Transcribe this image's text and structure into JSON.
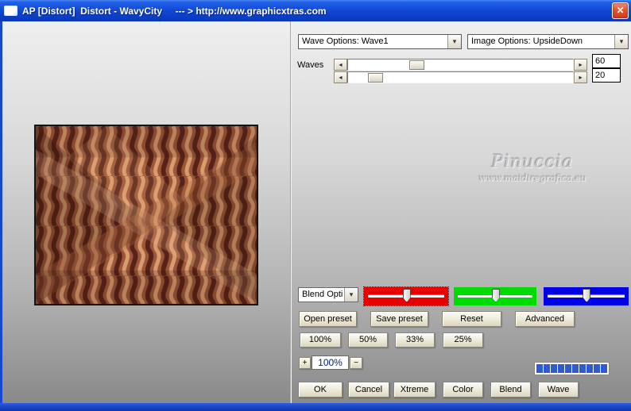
{
  "window": {
    "title": "AP [Distort]  Distort - WavyCity     --- > http://www.graphicxtras.com"
  },
  "icons": {
    "close": "✕",
    "dropdown_arrow": "▾",
    "arrow_left": "◂",
    "arrow_right": "▸",
    "plus": "+",
    "minus": "−"
  },
  "controls": {
    "wave_options_dropdown": "Wave Options: Wave1",
    "image_options_dropdown": "Image Options: UpsideDown",
    "waves_label": "Waves",
    "waves_value_top": "60",
    "waves_value_bottom": "20",
    "blend_dropdown": "Blend Opti",
    "zoom_value": "100%"
  },
  "watermark": {
    "name": "Pinuccia",
    "site": "www.maidiregrafica.eu"
  },
  "buttons": {
    "preset_row": [
      "Open preset",
      "Save preset",
      "Reset",
      "Advanced"
    ],
    "percent_row": [
      "100%",
      "50%",
      "33%",
      "25%"
    ],
    "action_row": [
      "OK",
      "Cancel",
      "Xtreme",
      "Color",
      "Blend",
      "Wave"
    ]
  },
  "colors": {
    "title_bar": "#0f45d2",
    "red_slider": "#e60000",
    "green_slider": "#00dc00",
    "blue_slider": "#0000e6",
    "progress_segment": "#2e5bd0",
    "preview_dark_brown": "#572318",
    "preview_mid_brown": "#9a573a",
    "preview_light_brown": "#d99c6c"
  },
  "progress": {
    "segments": 10
  }
}
